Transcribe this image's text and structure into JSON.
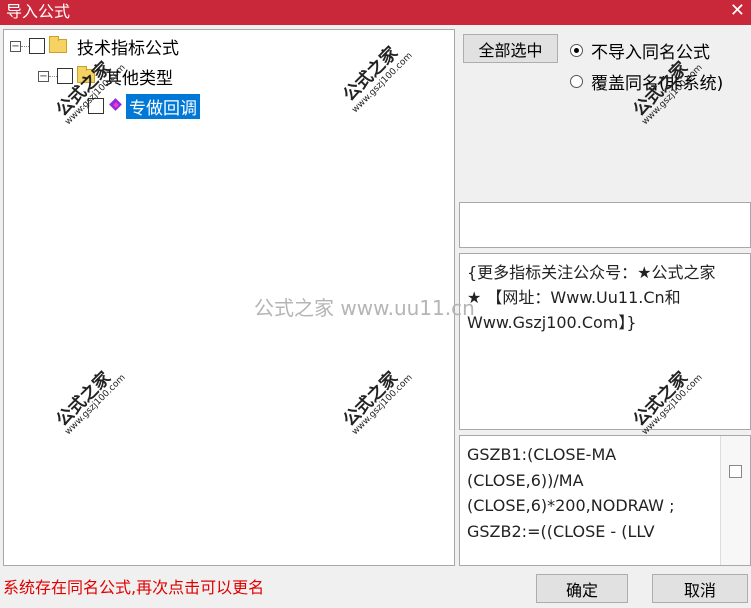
{
  "window": {
    "title": "导入公式",
    "close_glyph": "✕"
  },
  "tree": {
    "root_label": "技术指标公式",
    "child_label": "其他类型",
    "leaf_label": "专做回调",
    "expander_glyph": "−"
  },
  "buttons": {
    "select_all": "全部选中",
    "ok": "确定",
    "cancel": "取消"
  },
  "options": {
    "no_import_same_name": "不导入同名公式",
    "overwrite_same_name": "覆盖同名(非系统)",
    "selected": "no_import_same_name"
  },
  "description": "{更多指标关注公众号：★公式之家★ 【网址：Www.Uu11.Cn和Www.Gszj100.Com】}",
  "code_lines": [
    "GSZB1:(CLOSE-MA",
    "(CLOSE,6))/MA",
    "(CLOSE,6)*200,NODRAW ;",
    "GSZB2:=((CLOSE - (LLV"
  ],
  "status_message": "系统存在同名公式,再次点击可以更名",
  "watermark": {
    "text": "公式之家",
    "url": "www.gszj100.com",
    "center_text": "公式之家 www.uu11.cn"
  },
  "colors": {
    "titlebar": "#c8283a",
    "selection": "#0078d7",
    "status": "#e00000"
  }
}
